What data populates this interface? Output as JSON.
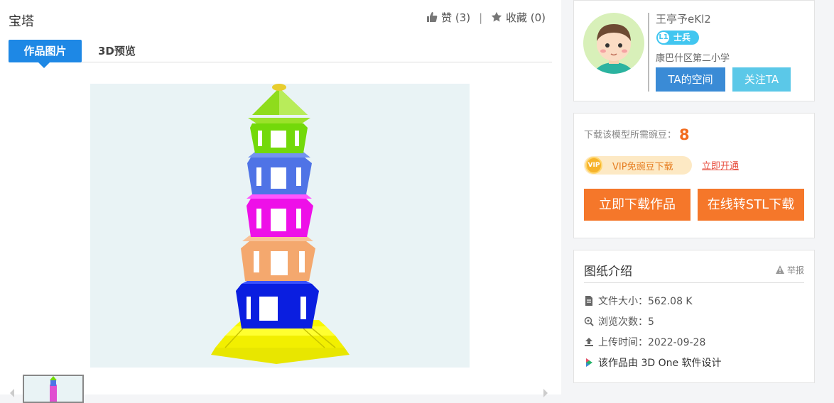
{
  "work": {
    "title": "宝塔",
    "like_label": "赞",
    "like_count": "(3)",
    "separator": "|",
    "fav_label": "收藏",
    "fav_count": "(0)"
  },
  "tabs": [
    {
      "label": "作品图片",
      "active": true
    },
    {
      "label": "3D预览",
      "active": false
    }
  ],
  "author": {
    "name": "王亭予eKl2",
    "level": "L1",
    "rank": "士兵",
    "school": "康巴什区第二小学",
    "space_button": "TA的空间",
    "follow_button": "关注TA"
  },
  "download": {
    "beans_label": "下载该模型所需豌豆：",
    "beans_value": "8",
    "vip_label": "VIP免豌豆下载",
    "vip_coin": "VIP",
    "vip_open_link": "立即开通",
    "download_button": "立即下载作品",
    "stl_button": "在线转STL下载"
  },
  "info": {
    "title": "图纸介绍",
    "report_label": "举报",
    "file_size": "文件大小：562.08 K",
    "views": "浏览次数：5",
    "upload_time": "上传时间：2022-09-28",
    "designed_by": "该作品由 3D One 软件设计"
  },
  "colors": {
    "accent_blue": "#1e88e5",
    "orange": "#f5772a",
    "badge_cyan": "#41c6f0"
  }
}
